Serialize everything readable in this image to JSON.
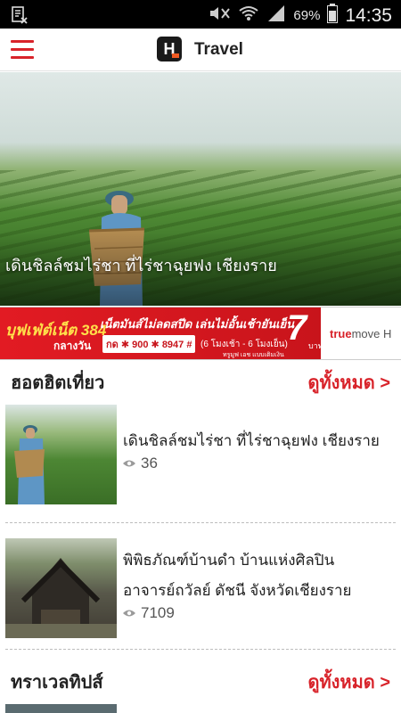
{
  "status_bar": {
    "battery": "69%",
    "time": "14:35"
  },
  "app_bar": {
    "title": "Travel",
    "logo_letter": "H"
  },
  "hero": {
    "caption": "เดินชิลล์ชมไร่ชา ที่ไร่ชาฉุยฟง เชียงราย",
    "slide_count": 6,
    "active_slide": 1
  },
  "banner": {
    "line1": "บุฟเฟ่ต์เน็ต 384",
    "line2": "กลางวัน",
    "promo": "เน็ตมันส์ไม่ลดสปีด เล่นไม่อั้นเช้ายันเย็น",
    "code": "กด ✱ 900 ✱ 8947 #",
    "dates": "(6 โมงเช้า - 6 โมงเย็น)",
    "note": "ทรูมูฟ เอช แบบเติมเงิน",
    "price": "7",
    "unit": "บาท",
    "brand_a": "true",
    "brand_b": "move H"
  },
  "section_hot": {
    "title": "ฮอตฮิตเที่ยว",
    "more": "ดูทั้งหมด >"
  },
  "hot_items": [
    {
      "title_line1": "เดินชิลล์ชมไร่ชา ที่ไร่ชาฉุยฟง เชียงราย",
      "title_line2": "",
      "views": "36"
    },
    {
      "title_line1": "พิพิธภัณฑ์บ้านดำ บ้านแห่งศิลปิน",
      "title_line2": "อาจารย์ถวัลย์ ดัชนี จังหวัดเชียงราย",
      "views": "7109"
    }
  ],
  "section_tips": {
    "title": "ทราเวลทิปส์",
    "more": "ดูทั้งหมด >"
  },
  "colors": {
    "accent": "#d8232a",
    "statusbar": "#000000"
  }
}
